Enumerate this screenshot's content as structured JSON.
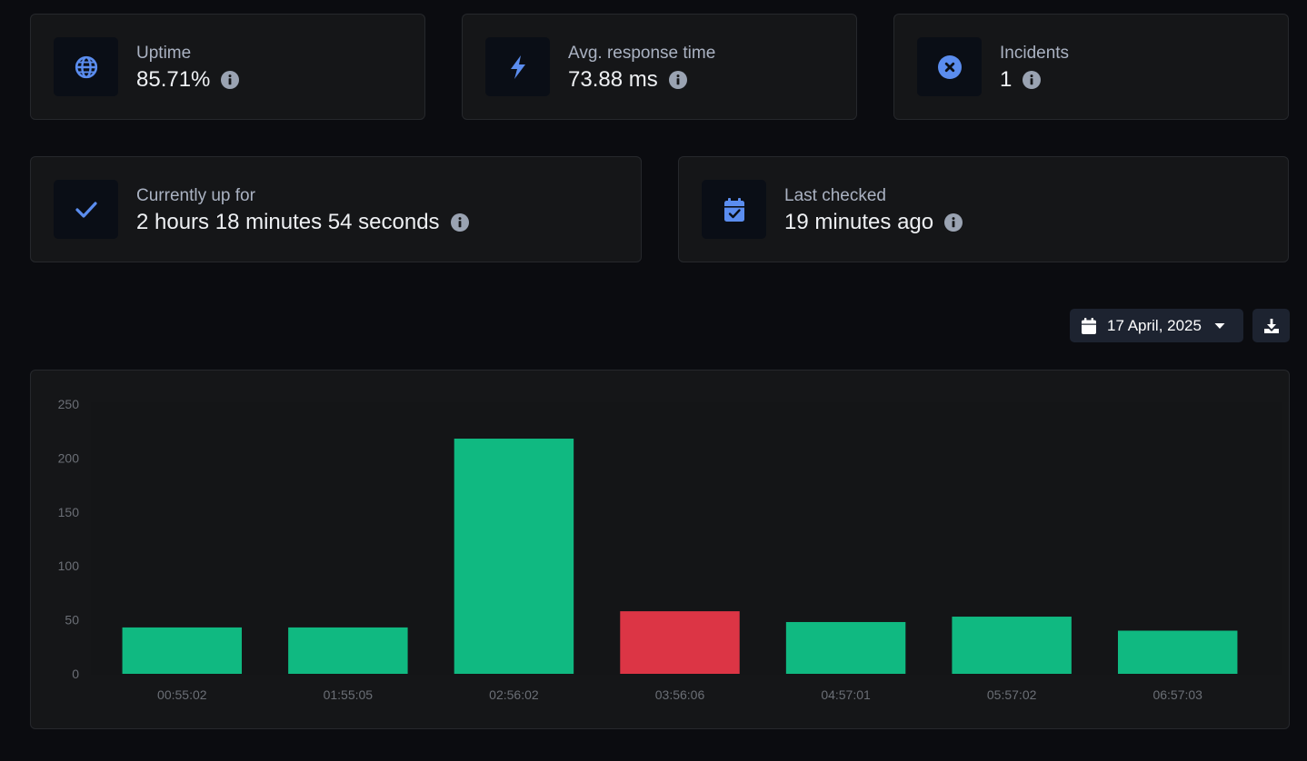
{
  "stats_row1": [
    {
      "label": "Uptime",
      "value": "85.71%",
      "icon": "globe-icon"
    },
    {
      "label": "Avg. response time",
      "value": "73.88 ms",
      "icon": "bolt-icon"
    },
    {
      "label": "Incidents",
      "value": "1",
      "icon": "circle-x-icon"
    }
  ],
  "stats_row2": [
    {
      "label": "Currently up for",
      "value": "2 hours 18 minutes 54 seconds",
      "icon": "check-icon"
    },
    {
      "label": "Last checked",
      "value": "19 minutes ago",
      "icon": "calendar-check-icon"
    }
  ],
  "toolbar": {
    "date_label": "17 April, 2025",
    "date_icon": "calendar-icon",
    "download_icon": "download-icon"
  },
  "colors": {
    "accent_blue": "#5b8def",
    "bar_up": "#10b981",
    "bar_down": "#dc3545",
    "info_icon": "#9aa3b2"
  },
  "chart_data": {
    "type": "bar",
    "categories": [
      "00:55:02",
      "01:55:05",
      "02:56:02",
      "03:56:06",
      "04:57:01",
      "05:57:02",
      "06:57:03"
    ],
    "values": [
      43,
      43,
      218,
      58,
      48,
      53,
      40
    ],
    "status": [
      "up",
      "up",
      "up",
      "down",
      "up",
      "up",
      "up"
    ],
    "ylim": [
      0,
      250
    ],
    "yticks": [
      0,
      50,
      100,
      150,
      200,
      250
    ],
    "grid": false
  }
}
